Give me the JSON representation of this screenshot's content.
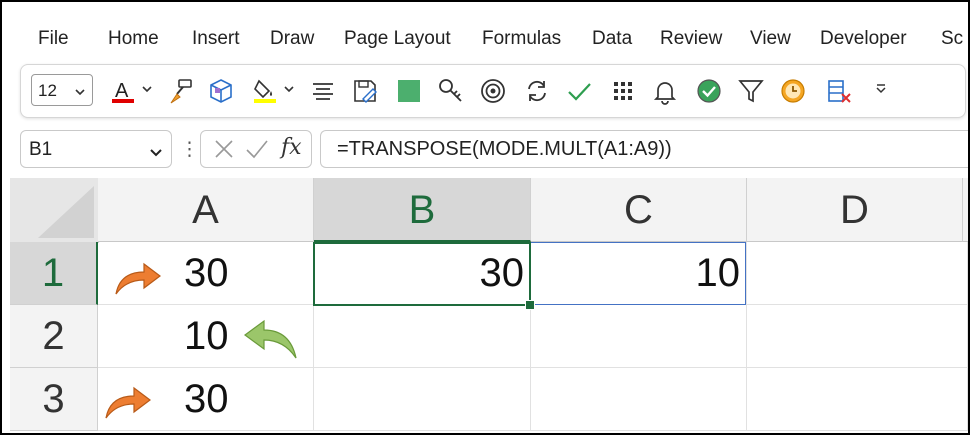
{
  "menu": {
    "items": [
      "File",
      "Home",
      "Insert",
      "Draw",
      "Page Layout",
      "Formulas",
      "Data",
      "Review",
      "View",
      "Developer",
      "Sc"
    ]
  },
  "toolbar": {
    "font_size": "12",
    "icons": [
      "font-color-icon",
      "format-painter-icon",
      "3d-cube-icon",
      "fill-color-icon",
      "align-center-icon",
      "save-edit-icon",
      "green-square-icon",
      "key-icon",
      "target-icon",
      "refresh-icon",
      "checkmark-icon",
      "grid-icon",
      "bell-icon",
      "green-check-circle-icon",
      "filter-icon",
      "clock-icon",
      "clear-column-icon",
      "more-icon"
    ],
    "colors": {
      "font_color_bar": "#e00000",
      "fill_color_bar": "#ffff00",
      "green_square": "#4caf6e"
    }
  },
  "formula_bar": {
    "name_box": "B1",
    "fx_label": "fx",
    "formula": "=TRANSPOSE(MODE.MULT(A1:A9))"
  },
  "grid": {
    "columns": [
      "A",
      "B",
      "C",
      "D"
    ],
    "rows": [
      "1",
      "2",
      "3"
    ],
    "cells": {
      "A1": "30",
      "A2": "10",
      "A3": "30",
      "B1": "30",
      "C1": "10"
    },
    "selected_column": "B",
    "selected_row": "1",
    "colors": {
      "selection_green": "#1e6b3c",
      "range_blue": "#4472c4",
      "arrow_orange": "#ed7d31",
      "arrow_green": "#8fbc5a"
    }
  }
}
